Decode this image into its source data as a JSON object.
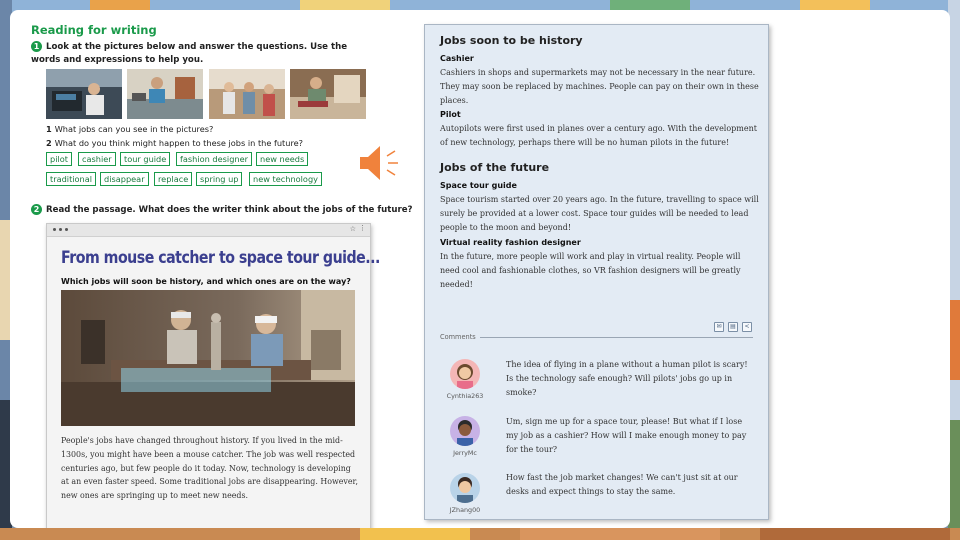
{
  "left": {
    "section_title": "Reading for writing",
    "q1_number": "1",
    "q1_text": "Look at the pictures below and answer the questions. Use the words and expressions to help you.",
    "sub_questions": [
      {
        "num": "1",
        "text": "What jobs can you see in the pictures?"
      },
      {
        "num": "2",
        "text": "What do you think might happen to these jobs in the future?"
      }
    ],
    "tags": [
      "pilot",
      "cashier",
      "tour guide",
      "fashion designer",
      "new needs",
      "traditional",
      "disappear",
      "replace",
      "spring up",
      "new technology"
    ],
    "q2_number": "2",
    "q2_text": "Read the passage. What does the writer think about the jobs of the future?",
    "article": {
      "headline": "From mouse catcher to space tour guide...",
      "subhead": "Which jobs will soon be history, and which ones are on the way?",
      "body": "People's jobs have changed throughout history. If you lived in the mid-1300s, you might have been a mouse catcher. The job was well respected centuries ago, but few people do it today. Now, technology is developing at an even faster speed. Some traditional jobs are disappearing. However, new ones are springing up to meet new needs."
    }
  },
  "right": {
    "history_title": "Jobs soon to be history",
    "cashier_head": "Cashier",
    "cashier_text": "Cashiers in shops and supermarkets may not be necessary in the near future. They may soon be replaced by machines. People can pay on their own in these places.",
    "pilot_head": "Pilot",
    "pilot_text": "Autopilots were first used in planes over a century ago. With the development of new technology, perhaps there will be no human pilots in the future!",
    "future_title": "Jobs of the future",
    "space_head": "Space tour guide",
    "space_text": "Space tourism started over 20 years ago. In the future, travelling to space will surely be provided at a lower cost. Space tour guides will be needed to lead people to the moon and beyond!",
    "vr_head": "Virtual reality fashion designer",
    "vr_text": "In the future, more people will work and play in virtual reality. People will need cool and fashionable clothes, so VR fashion designers will be greatly needed!",
    "comments_label": "Comments",
    "comments": [
      {
        "user": "Cynthia263",
        "text": "The idea of flying in a plane without a human pilot is scary! Is the technology safe enough? Will pilots' jobs go up in smoke?"
      },
      {
        "user": "JerryMc",
        "text": "Um, sign me up for a space tour, please! But what if I lose my job as a cashier? How will I make enough money to pay for the tour?"
      },
      {
        "user": "JZhang00",
        "text": "How fast the job market changes! We can't just sit at our desks and expect things to stay the same."
      }
    ]
  },
  "colors": {
    "accent_green": "#1a9a4a",
    "headline_blue": "#3b3f8f",
    "card_bg": "#e3ebf4",
    "speaker_orange": "#f0823c"
  },
  "icons": [
    "speaker-icon",
    "star-icon",
    "menu-icon",
    "mail-icon",
    "print-icon",
    "share-icon"
  ]
}
